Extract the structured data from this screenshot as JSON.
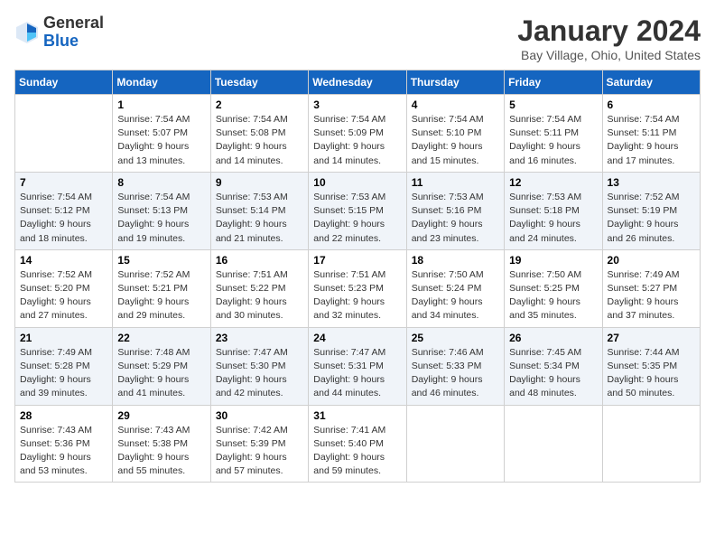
{
  "header": {
    "logo_general": "General",
    "logo_blue": "Blue",
    "month_title": "January 2024",
    "location": "Bay Village, Ohio, United States"
  },
  "days_of_week": [
    "Sunday",
    "Monday",
    "Tuesday",
    "Wednesday",
    "Thursday",
    "Friday",
    "Saturday"
  ],
  "weeks": [
    [
      {
        "day": "",
        "sunrise": "",
        "sunset": "",
        "daylight": ""
      },
      {
        "day": "1",
        "sunrise": "Sunrise: 7:54 AM",
        "sunset": "Sunset: 5:07 PM",
        "daylight": "Daylight: 9 hours and 13 minutes."
      },
      {
        "day": "2",
        "sunrise": "Sunrise: 7:54 AM",
        "sunset": "Sunset: 5:08 PM",
        "daylight": "Daylight: 9 hours and 14 minutes."
      },
      {
        "day": "3",
        "sunrise": "Sunrise: 7:54 AM",
        "sunset": "Sunset: 5:09 PM",
        "daylight": "Daylight: 9 hours and 14 minutes."
      },
      {
        "day": "4",
        "sunrise": "Sunrise: 7:54 AM",
        "sunset": "Sunset: 5:10 PM",
        "daylight": "Daylight: 9 hours and 15 minutes."
      },
      {
        "day": "5",
        "sunrise": "Sunrise: 7:54 AM",
        "sunset": "Sunset: 5:11 PM",
        "daylight": "Daylight: 9 hours and 16 minutes."
      },
      {
        "day": "6",
        "sunrise": "Sunrise: 7:54 AM",
        "sunset": "Sunset: 5:11 PM",
        "daylight": "Daylight: 9 hours and 17 minutes."
      }
    ],
    [
      {
        "day": "7",
        "sunrise": "Sunrise: 7:54 AM",
        "sunset": "Sunset: 5:12 PM",
        "daylight": "Daylight: 9 hours and 18 minutes."
      },
      {
        "day": "8",
        "sunrise": "Sunrise: 7:54 AM",
        "sunset": "Sunset: 5:13 PM",
        "daylight": "Daylight: 9 hours and 19 minutes."
      },
      {
        "day": "9",
        "sunrise": "Sunrise: 7:53 AM",
        "sunset": "Sunset: 5:14 PM",
        "daylight": "Daylight: 9 hours and 21 minutes."
      },
      {
        "day": "10",
        "sunrise": "Sunrise: 7:53 AM",
        "sunset": "Sunset: 5:15 PM",
        "daylight": "Daylight: 9 hours and 22 minutes."
      },
      {
        "day": "11",
        "sunrise": "Sunrise: 7:53 AM",
        "sunset": "Sunset: 5:16 PM",
        "daylight": "Daylight: 9 hours and 23 minutes."
      },
      {
        "day": "12",
        "sunrise": "Sunrise: 7:53 AM",
        "sunset": "Sunset: 5:18 PM",
        "daylight": "Daylight: 9 hours and 24 minutes."
      },
      {
        "day": "13",
        "sunrise": "Sunrise: 7:52 AM",
        "sunset": "Sunset: 5:19 PM",
        "daylight": "Daylight: 9 hours and 26 minutes."
      }
    ],
    [
      {
        "day": "14",
        "sunrise": "Sunrise: 7:52 AM",
        "sunset": "Sunset: 5:20 PM",
        "daylight": "Daylight: 9 hours and 27 minutes."
      },
      {
        "day": "15",
        "sunrise": "Sunrise: 7:52 AM",
        "sunset": "Sunset: 5:21 PM",
        "daylight": "Daylight: 9 hours and 29 minutes."
      },
      {
        "day": "16",
        "sunrise": "Sunrise: 7:51 AM",
        "sunset": "Sunset: 5:22 PM",
        "daylight": "Daylight: 9 hours and 30 minutes."
      },
      {
        "day": "17",
        "sunrise": "Sunrise: 7:51 AM",
        "sunset": "Sunset: 5:23 PM",
        "daylight": "Daylight: 9 hours and 32 minutes."
      },
      {
        "day": "18",
        "sunrise": "Sunrise: 7:50 AM",
        "sunset": "Sunset: 5:24 PM",
        "daylight": "Daylight: 9 hours and 34 minutes."
      },
      {
        "day": "19",
        "sunrise": "Sunrise: 7:50 AM",
        "sunset": "Sunset: 5:25 PM",
        "daylight": "Daylight: 9 hours and 35 minutes."
      },
      {
        "day": "20",
        "sunrise": "Sunrise: 7:49 AM",
        "sunset": "Sunset: 5:27 PM",
        "daylight": "Daylight: 9 hours and 37 minutes."
      }
    ],
    [
      {
        "day": "21",
        "sunrise": "Sunrise: 7:49 AM",
        "sunset": "Sunset: 5:28 PM",
        "daylight": "Daylight: 9 hours and 39 minutes."
      },
      {
        "day": "22",
        "sunrise": "Sunrise: 7:48 AM",
        "sunset": "Sunset: 5:29 PM",
        "daylight": "Daylight: 9 hours and 41 minutes."
      },
      {
        "day": "23",
        "sunrise": "Sunrise: 7:47 AM",
        "sunset": "Sunset: 5:30 PM",
        "daylight": "Daylight: 9 hours and 42 minutes."
      },
      {
        "day": "24",
        "sunrise": "Sunrise: 7:47 AM",
        "sunset": "Sunset: 5:31 PM",
        "daylight": "Daylight: 9 hours and 44 minutes."
      },
      {
        "day": "25",
        "sunrise": "Sunrise: 7:46 AM",
        "sunset": "Sunset: 5:33 PM",
        "daylight": "Daylight: 9 hours and 46 minutes."
      },
      {
        "day": "26",
        "sunrise": "Sunrise: 7:45 AM",
        "sunset": "Sunset: 5:34 PM",
        "daylight": "Daylight: 9 hours and 48 minutes."
      },
      {
        "day": "27",
        "sunrise": "Sunrise: 7:44 AM",
        "sunset": "Sunset: 5:35 PM",
        "daylight": "Daylight: 9 hours and 50 minutes."
      }
    ],
    [
      {
        "day": "28",
        "sunrise": "Sunrise: 7:43 AM",
        "sunset": "Sunset: 5:36 PM",
        "daylight": "Daylight: 9 hours and 53 minutes."
      },
      {
        "day": "29",
        "sunrise": "Sunrise: 7:43 AM",
        "sunset": "Sunset: 5:38 PM",
        "daylight": "Daylight: 9 hours and 55 minutes."
      },
      {
        "day": "30",
        "sunrise": "Sunrise: 7:42 AM",
        "sunset": "Sunset: 5:39 PM",
        "daylight": "Daylight: 9 hours and 57 minutes."
      },
      {
        "day": "31",
        "sunrise": "Sunrise: 7:41 AM",
        "sunset": "Sunset: 5:40 PM",
        "daylight": "Daylight: 9 hours and 59 minutes."
      },
      {
        "day": "",
        "sunrise": "",
        "sunset": "",
        "daylight": ""
      },
      {
        "day": "",
        "sunrise": "",
        "sunset": "",
        "daylight": ""
      },
      {
        "day": "",
        "sunrise": "",
        "sunset": "",
        "daylight": ""
      }
    ]
  ]
}
